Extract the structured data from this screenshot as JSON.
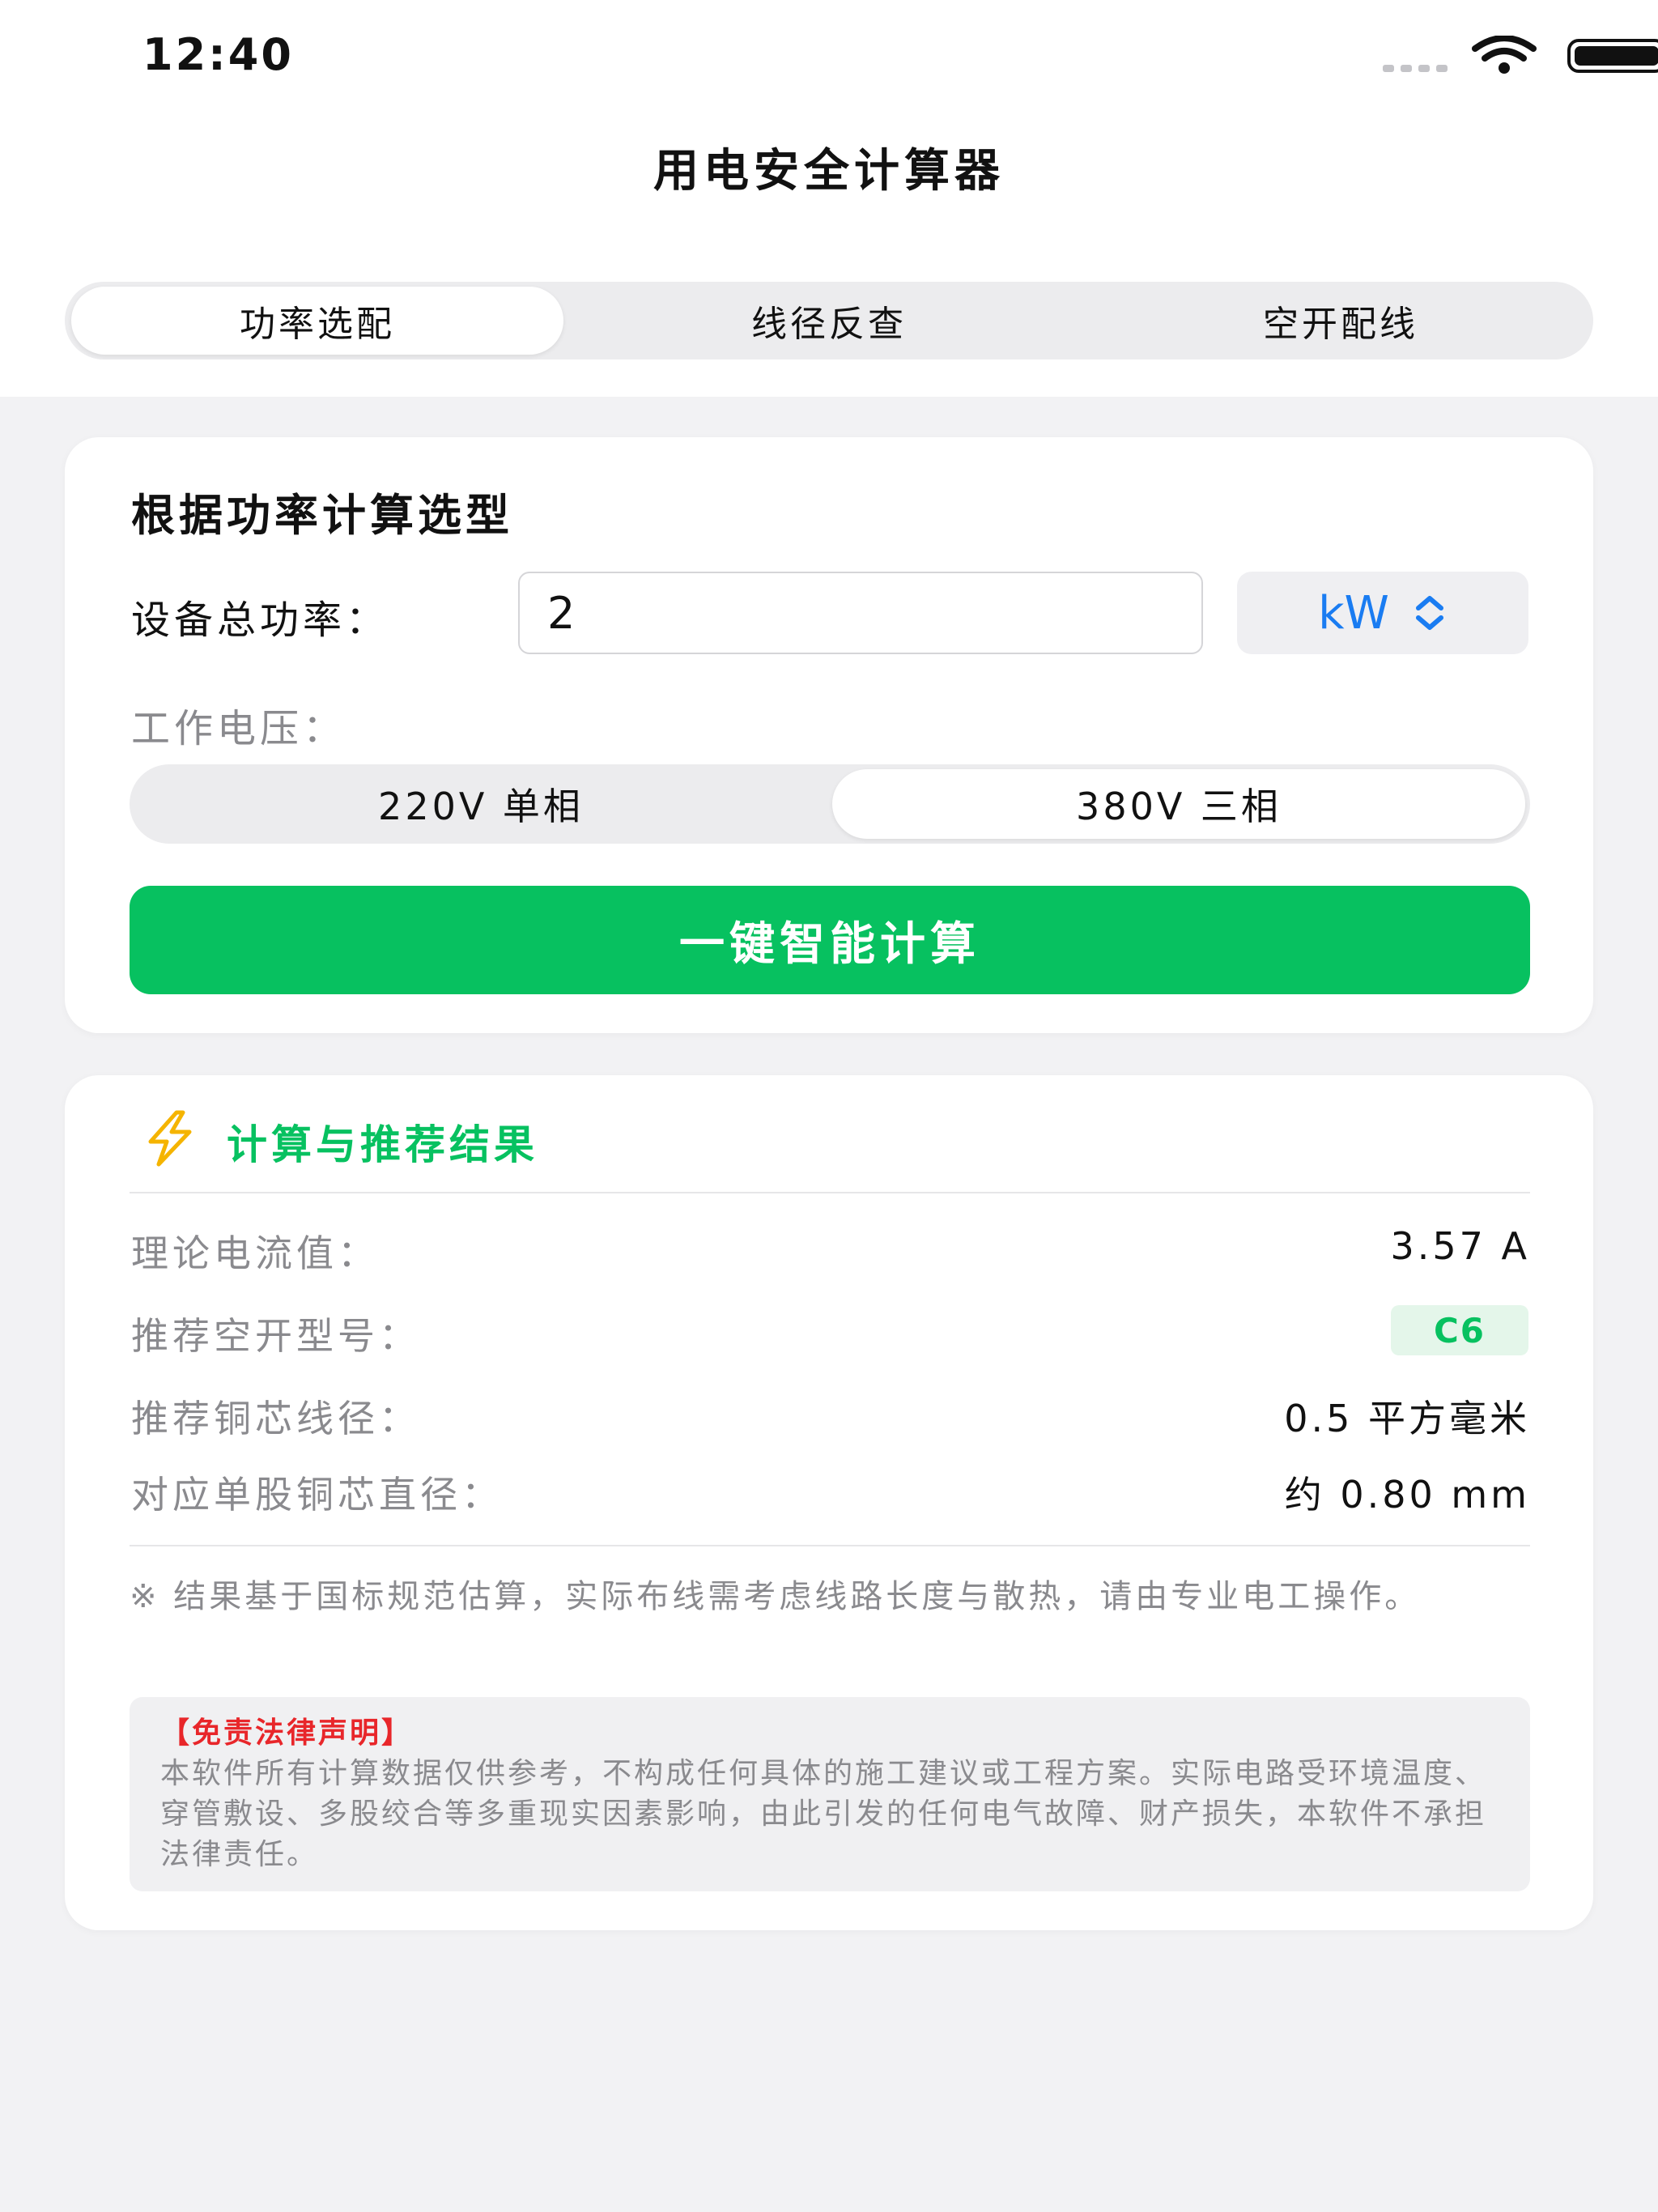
{
  "status": {
    "time": "12:40"
  },
  "app": {
    "title": "用电安全计算器"
  },
  "tabs": [
    {
      "label": "功率选配",
      "active": true
    },
    {
      "label": "线径反查",
      "active": false
    },
    {
      "label": "空开配线",
      "active": false
    }
  ],
  "form": {
    "title": "根据功率计算选型",
    "power_label": "设备总功率：",
    "power_value": "2",
    "unit": "kW",
    "voltage_label": "工作电压：",
    "voltage_options": [
      {
        "label": "220V 单相",
        "selected": false
      },
      {
        "label": "380V 三相",
        "selected": true
      }
    ],
    "calc_button": "一键智能计算"
  },
  "result": {
    "title": "计算与推荐结果",
    "rows": [
      {
        "label": "理论电流值：",
        "value": "3.57 A"
      },
      {
        "label": "推荐空开型号：",
        "value": "C6"
      },
      {
        "label": "推荐铜芯线径：",
        "value": "0.5 平方毫米"
      },
      {
        "label": "对应单股铜芯直径：",
        "value": "约 0.80 mm"
      }
    ],
    "note": "※ 结果基于国标规范估算，实际布线需考虑线路长度与散热，请由专业电工操作。",
    "disclaimer_title": "【免责法律声明】",
    "disclaimer_body": "本软件所有计算数据仅供参考，不构成任何具体的施工建议或工程方案。实际电路受环境温度、穿管敷设、多股绞合等多重现实因素影响，由此引发的任何电气故障、财产损失，本软件不承担法律责任。"
  },
  "colors": {
    "accent": "#07c160",
    "link": "#1a7cf2",
    "warning": "#e8262a",
    "bolt": "#f5b400"
  }
}
